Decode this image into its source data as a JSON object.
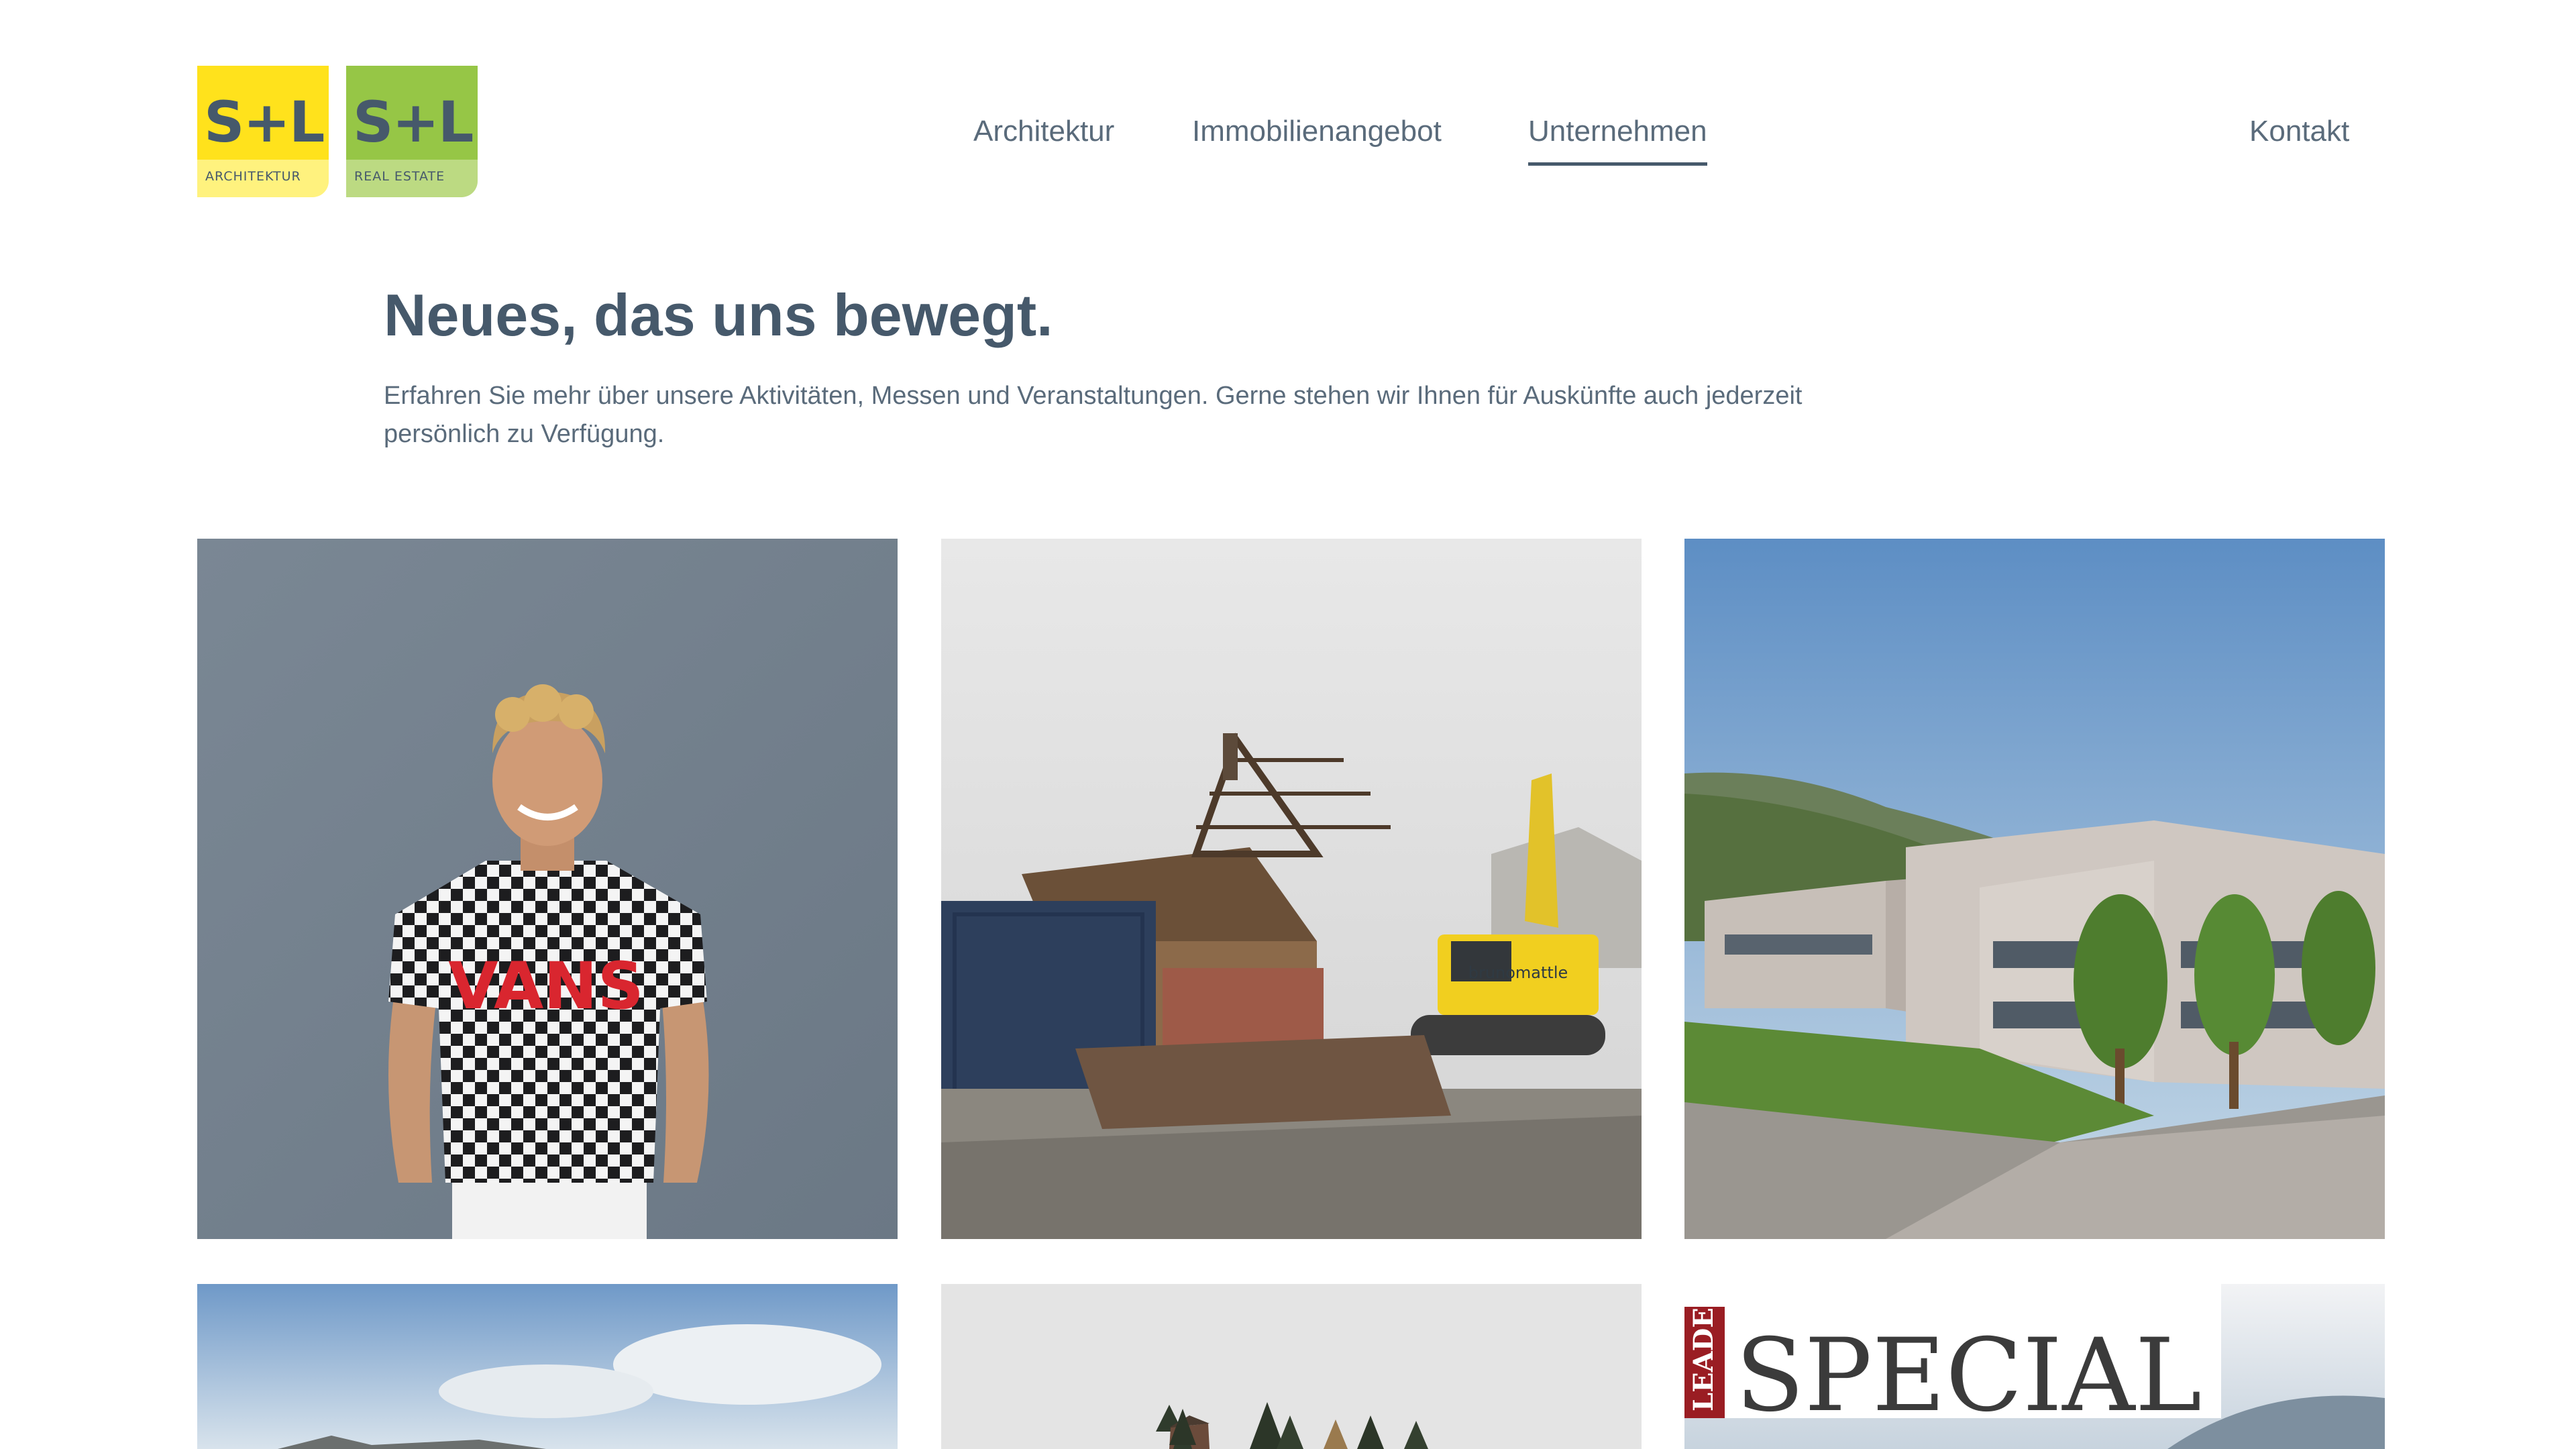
{
  "header": {
    "logos": [
      {
        "mark": "S+L",
        "sub": "ARCHITEKTUR",
        "colors": {
          "top": "#ffe21c",
          "bottom": "#fff27e"
        }
      },
      {
        "mark": "S+L",
        "sub": "REAL ESTATE",
        "colors": {
          "top": "#96c646",
          "bottom": "#bcda82"
        }
      }
    ],
    "nav": [
      {
        "label": "Architektur",
        "active": false
      },
      {
        "label": "Immobilienangebot",
        "active": false
      },
      {
        "label": "Unternehmen",
        "active": true
      }
    ],
    "contact_label": "Kontakt"
  },
  "main": {
    "title": "Neues, das uns bewegt.",
    "intro": "Erfahren Sie mehr über unsere Aktivitäten, Messen und Veranstaltungen. Gerne stehen wir Ihnen für Auskünfte auch jederzeit persönlich zu Verfügung."
  },
  "grid": {
    "tiles": [
      {
        "tshirt_text": "VANS"
      },
      {
        "excavator_text": "brunomattle"
      },
      {},
      {},
      {},
      {
        "leader_text": "LEADER",
        "special_text": "SPECIAL"
      }
    ]
  },
  "theme": {
    "text_color": "#46596b",
    "nav_color": "#5a6b7b"
  }
}
